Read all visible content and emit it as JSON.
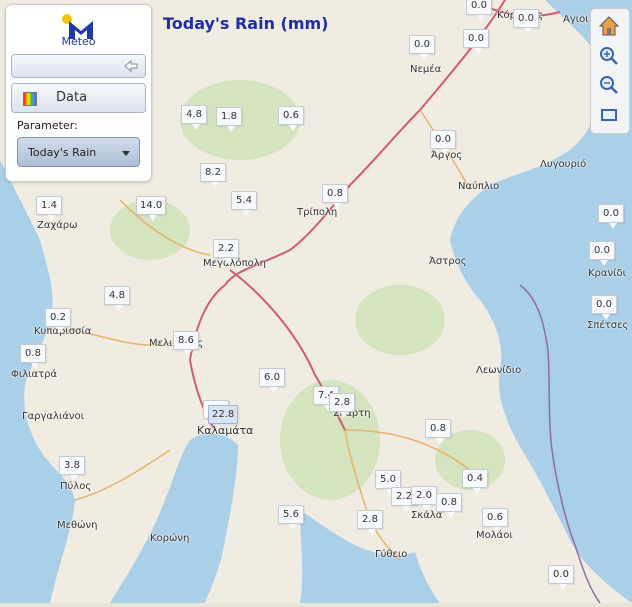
{
  "header": {
    "title": "Today's Rain (mm)"
  },
  "panel": {
    "logo_text": "Meteo",
    "data_button_label": "Data",
    "parameter_label": "Parameter:",
    "parameter_selected": "Today's Rain"
  },
  "toolbar": {
    "home": "home-icon",
    "zoom_in": "zoom-in-icon",
    "zoom_out": "zoom-out-icon",
    "extent": "extent-icon"
  },
  "places": [
    "Κόρινθος",
    "Αγιοι",
    "Νεμέα",
    "Άργος",
    "Λυγουριό",
    "Ναύπλιο",
    "Τρίπολη",
    "Ζαχάρω",
    "Μεγαλόπολη",
    "Άστρος",
    "Κρανίδι",
    "Σπέτσες",
    "Κυπαρισσία",
    "Φιλιατρά",
    "Μελιγαλάς",
    "Λεωνίδιο",
    "Γαργαλιάνοι",
    "Καλαμάτα",
    "Σπάρτη",
    "Πύλος",
    "Μεθώνη",
    "Κορώνη",
    "Σκάλα",
    "Μολάοι",
    "Γύθειο"
  ],
  "rain": {
    "top1": "0.0",
    "top2": "0.0",
    "nemea": "0.0",
    "argos_n": "0.0",
    "korinthos": "0.0",
    "b48": "4.8",
    "b18": "1.8",
    "b06": "0.6",
    "argos": "0.0",
    "b82": "8.2",
    "tripoli": "0.8",
    "b54": "5.4",
    "z14": "1.4",
    "b140": "14.0",
    "b02sp": "0.0",
    "b22": "2.2",
    "b0kr": "0.0",
    "b0spet": "0.0",
    "b48b": "4.8",
    "k02": "0.2",
    "f08": "0.8",
    "m86": "8.6",
    "b60": "6.0",
    "b74": "7.4",
    "b28": "2.8",
    "kal1": "1.",
    "kal228": "22.8",
    "b08e": "0.8",
    "p38": "3.8",
    "b50": "5.0",
    "b22b": "2.2",
    "b20": "2.0",
    "b08s": "0.8",
    "b04": "0.4",
    "b56": "5.6",
    "b28b": "2.8",
    "b06m": "0.6",
    "b00g": "0.0"
  }
}
